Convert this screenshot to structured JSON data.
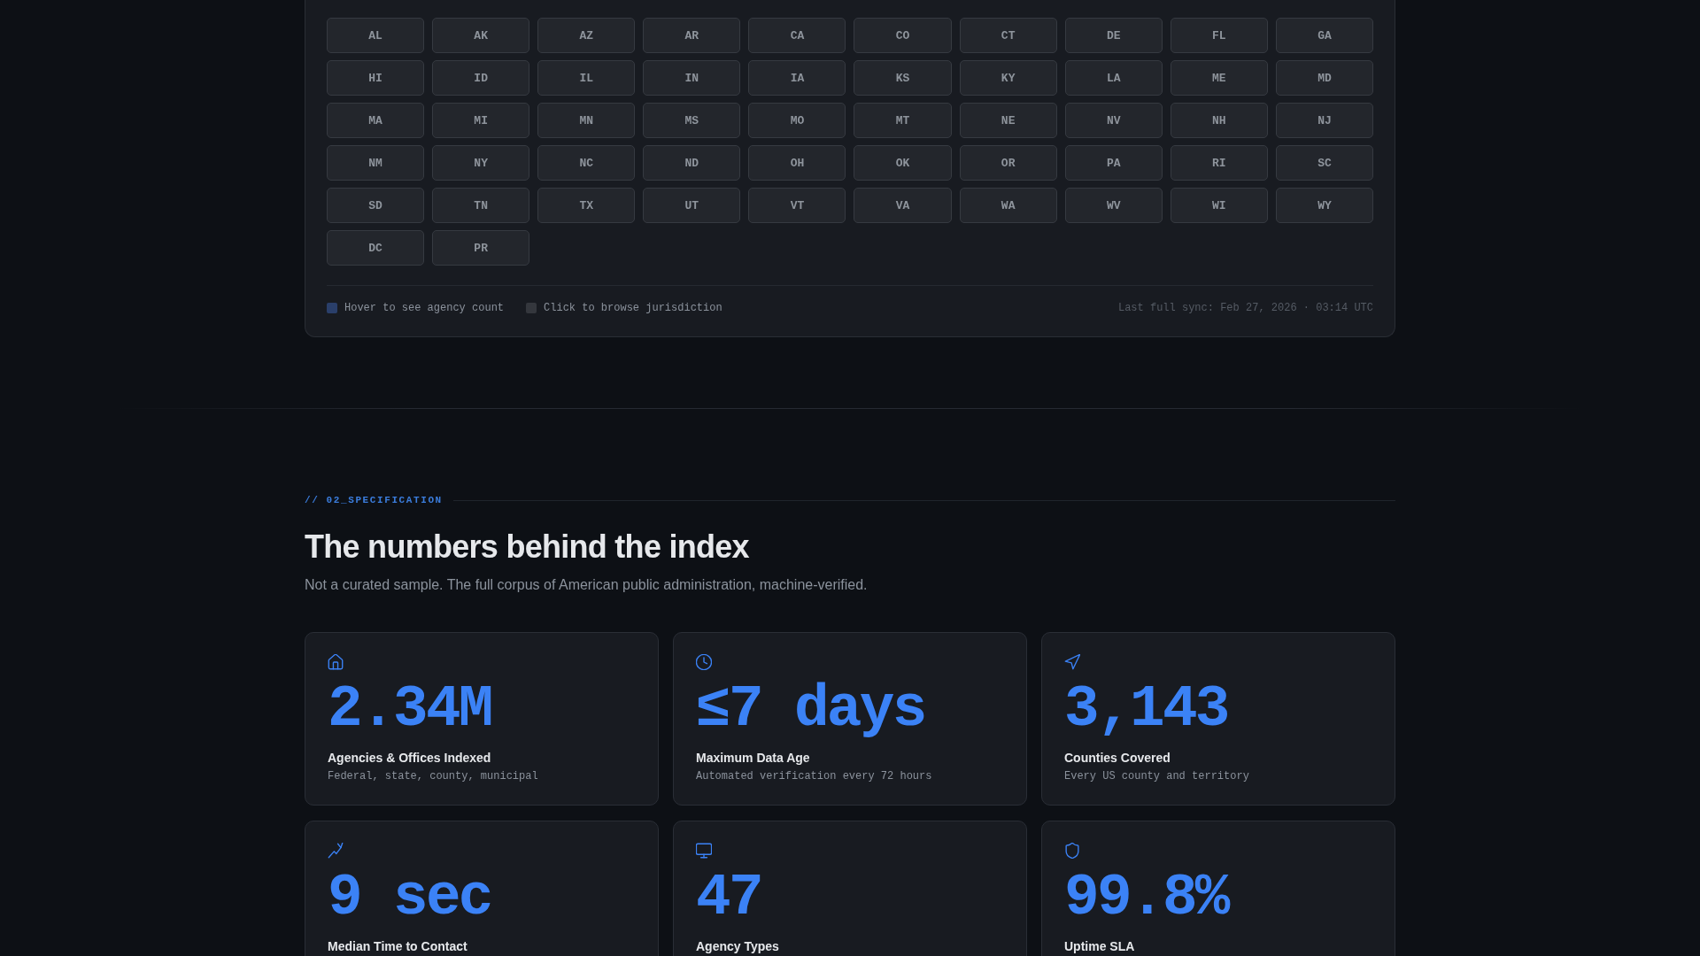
{
  "states_panel": {
    "states": [
      "AL",
      "AK",
      "AZ",
      "AR",
      "CA",
      "CO",
      "CT",
      "DE",
      "FL",
      "GA",
      "HI",
      "ID",
      "IL",
      "IN",
      "IA",
      "KS",
      "KY",
      "LA",
      "ME",
      "MD",
      "MA",
      "MI",
      "MN",
      "MS",
      "MO",
      "MT",
      "NE",
      "NV",
      "NH",
      "NJ",
      "NM",
      "NY",
      "NC",
      "ND",
      "OH",
      "OK",
      "OR",
      "PA",
      "RI",
      "SC",
      "SD",
      "TN",
      "TX",
      "UT",
      "VT",
      "VA",
      "WA",
      "WV",
      "WI",
      "WY",
      "DC",
      "PR"
    ],
    "legend": [
      {
        "label": "Hover to see agency count",
        "color": "#2a3f6a"
      },
      {
        "label": "Click to browse jurisdiction",
        "color": "#34373d"
      }
    ],
    "sync_status": "Last full sync: Feb 27, 2026 · 03:14 UTC"
  },
  "section": {
    "label": "// 02_SPECIFICATION",
    "title": "The numbers behind the index",
    "subtitle": "Not a curated sample. The full corpus of American public administration, machine-verified."
  },
  "stats": [
    {
      "value": "2.34M",
      "label": "Agencies & Offices Indexed",
      "description": "Federal, state, county, municipal"
    },
    {
      "value": "≤7 days",
      "label": "Maximum Data Age",
      "description": "Automated verification every 72 hours"
    },
    {
      "value": "3,143",
      "label": "Counties Covered",
      "description": "Every US county and territory"
    },
    {
      "value": "9 sec",
      "label": "Median Time to Contact"
    },
    {
      "value": "47",
      "label": "Agency Types"
    },
    {
      "value": "99.8%",
      "label": "Uptime SLA"
    }
  ]
}
